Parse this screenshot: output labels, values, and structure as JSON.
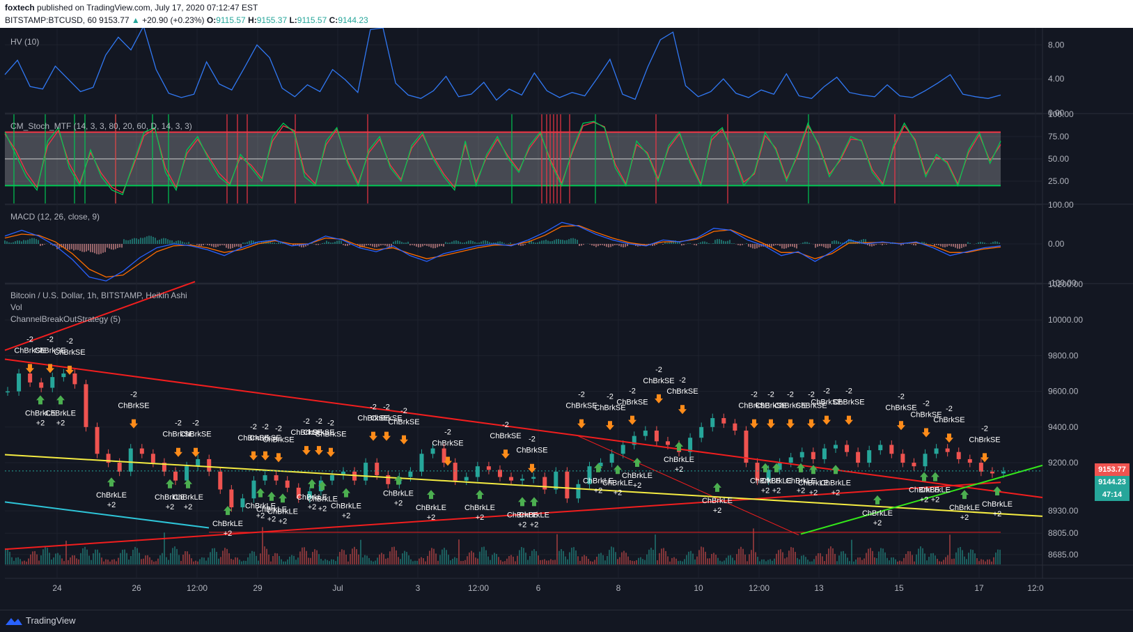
{
  "header": {
    "author": "foxtech",
    "published_text": "published on TradingView.com, July 17, 2020 07:12:47 EST",
    "symbol": "BITSTAMP:BTCUSD, 60",
    "last": "9153.77",
    "change": "+20.90 (+0.23%)",
    "change_arrow": "▲",
    "o_label": "O:",
    "o_value": "9115.57",
    "h_label": "H:",
    "h_value": "9155.37",
    "l_label": "L:",
    "l_value": "9115.57",
    "c_label": "C:",
    "c_value": "9144.23"
  },
  "panes": {
    "hv": {
      "title": "HV (10)",
      "ticks": [
        "8.00",
        "4.00",
        "0.00"
      ]
    },
    "stoch": {
      "title": "CM_Stoch_MTF (14, 3, 3, 80, 20, 60, D, 14, 3, 3)",
      "ticks": [
        "100.00",
        "75.00",
        "50.00",
        "25.00"
      ]
    },
    "macd": {
      "title": "MACD (12, 26, close, 9)",
      "ticks": [
        "100.00",
        "0.00",
        "-100.00"
      ]
    },
    "price": {
      "title": "Bitcoin / U.S. Dollar, 1h, BITSTAMP, Heikin Ashi",
      "vol_label": "Vol",
      "strategy_label": "ChannelBreakOutStrategy (5)",
      "ticks": [
        "10200.00",
        "10000.00",
        "9800.00",
        "9600.00",
        "9400.00",
        "9200.00",
        "8930.00",
        "8805.00",
        "8685.00"
      ]
    }
  },
  "price_tags": [
    {
      "value": "9153.77",
      "color": "#ef5350"
    },
    {
      "value": "9144.23",
      "color": "#26a69a"
    },
    {
      "value": "47:14",
      "color": "#26a69a"
    }
  ],
  "x_axis": [
    "24",
    "26",
    "12:00",
    "29",
    "Jul",
    "3",
    "12:00",
    "6",
    "8",
    "10",
    "12:00",
    "13",
    "15",
    "17",
    "12:0"
  ],
  "signals": {
    "short_label": "ChBrkSE",
    "short_qty": "-2",
    "long_label": "ChBrkLE",
    "long_qty": "+2"
  },
  "footer": {
    "logo_text": "TradingView"
  },
  "colors": {
    "background": "#131722",
    "grid": "#1e222d",
    "hv_line": "#3179f5",
    "stoch_k": "#00c853",
    "stoch_d": "#f23645",
    "macd_line": "#2962ff",
    "signal_line": "#ff6d00",
    "trend_red": "#f21e1e",
    "trend_yellow": "#f5ec42",
    "trend_cyan": "#2ec5d8",
    "trend_green": "#34e81a",
    "candle_up": "#26a69a",
    "candle_down": "#ef5350"
  },
  "chart_data": [
    {
      "type": "line",
      "pane": "HV (10)",
      "ylim": [
        0,
        10
      ],
      "series": [
        {
          "name": "HV (10)",
          "values": [
            4.5,
            6.2,
            3.1,
            2.8,
            5.5,
            4.0,
            2.5,
            3.0,
            6.8,
            8.9,
            7.4,
            10.2,
            5.1,
            2.3,
            1.8,
            2.2,
            6.0,
            3.4,
            2.7,
            5.3,
            8.0,
            6.5,
            2.9,
            1.9,
            3.3,
            2.5,
            5.1,
            3.9,
            2.4,
            9.8,
            10.0,
            3.5,
            2.1,
            1.7,
            2.6,
            4.3,
            1.9,
            2.2,
            3.6,
            1.5,
            2.8,
            2.1,
            4.7,
            2.6,
            1.8,
            2.4,
            2.0,
            4.1,
            6.3,
            2.2,
            1.6,
            5.4,
            8.6,
            9.5,
            3.2,
            1.9,
            2.5,
            4.0,
            2.3,
            1.8,
            2.7,
            2.2,
            4.6,
            2.0,
            1.7,
            3.1,
            4.2,
            2.4,
            2.1,
            1.9,
            3.3,
            2.0,
            1.8,
            2.6,
            3.5,
            4.5,
            2.2,
            1.9,
            1.7,
            2.1
          ]
        }
      ]
    },
    {
      "type": "line",
      "pane": "CM_Stoch_MTF (14, 3, 3, 80, 20, 60, D, 14, 3, 3)",
      "ylim": [
        0,
        100
      ],
      "series": [
        {
          "name": "K",
          "values": [
            80,
            55,
            30,
            15,
            70,
            85,
            40,
            20,
            60,
            30,
            15,
            10,
            45,
            80,
            85,
            35,
            15,
            60,
            75,
            50,
            30,
            20,
            55,
            40,
            25,
            75,
            90,
            80,
            30,
            20,
            70,
            85,
            45,
            20,
            60,
            75,
            40,
            25,
            65,
            80,
            50,
            30,
            15,
            70,
            20,
            55,
            75,
            50,
            35,
            65,
            80,
            45,
            20,
            60,
            90,
            92,
            85,
            40,
            20,
            70,
            55,
            25,
            65,
            80,
            45,
            20,
            75,
            85,
            55,
            20,
            35,
            80,
            60,
            25,
            55,
            90,
            65,
            30,
            50,
            75,
            70,
            35,
            20,
            65,
            90,
            70,
            30,
            55,
            45,
            20,
            60,
            80,
            45,
            70
          ]
        },
        {
          "name": "D",
          "values": [
            78,
            60,
            35,
            18,
            65,
            82,
            45,
            23,
            57,
            34,
            18,
            12,
            42,
            76,
            84,
            40,
            18,
            56,
            72,
            53,
            34,
            22,
            52,
            43,
            28,
            70,
            87,
            82,
            35,
            22,
            66,
            83,
            48,
            23,
            57,
            72,
            43,
            27,
            62,
            77,
            53,
            33,
            18,
            66,
            24,
            52,
            72,
            53,
            37,
            62,
            78,
            48,
            23,
            57,
            87,
            91,
            86,
            44,
            22,
            66,
            57,
            28,
            62,
            78,
            48,
            22,
            71,
            83,
            57,
            24,
            33,
            76,
            62,
            28,
            52,
            87,
            67,
            33,
            48,
            72,
            71,
            38,
            22,
            62,
            87,
            72,
            33,
            52,
            47,
            22,
            57,
            77,
            48,
            66
          ]
        }
      ]
    },
    {
      "type": "line",
      "pane": "MACD (12, 26, close, 9)",
      "ylim": [
        -100,
        100
      ],
      "series": [
        {
          "name": "MACD",
          "values": [
            20,
            35,
            20,
            -5,
            -40,
            -85,
            -95,
            -70,
            -35,
            -10,
            0,
            -5,
            -15,
            -30,
            -10,
            5,
            10,
            -5,
            0,
            20,
            10,
            -10,
            -20,
            -5,
            -30,
            -45,
            -25,
            -15,
            -5,
            0,
            -5,
            10,
            30,
            55,
            45,
            25,
            10,
            0,
            -5,
            10,
            5,
            15,
            40,
            35,
            10,
            -5,
            -30,
            -20,
            -45,
            -20,
            10,
            0,
            5,
            0,
            5,
            -10,
            -30,
            -20,
            -10,
            -5
          ]
        },
        {
          "name": "Signal",
          "values": [
            15,
            25,
            22,
            5,
            -25,
            -65,
            -85,
            -80,
            -50,
            -20,
            -5,
            -3,
            -10,
            -22,
            -15,
            0,
            8,
            0,
            0,
            15,
            12,
            -5,
            -15,
            -10,
            -25,
            -38,
            -30,
            -20,
            -10,
            -3,
            -3,
            5,
            22,
            45,
            47,
            30,
            15,
            3,
            -3,
            5,
            6,
            12,
            32,
            36,
            18,
            0,
            -22,
            -22,
            -38,
            -25,
            2,
            3,
            4,
            1,
            3,
            -5,
            -22,
            -22,
            -13,
            -8
          ]
        }
      ]
    },
    {
      "type": "line",
      "pane": "Bitcoin / U.S. Dollar, 1h, BITSTAMP, Heikin Ashi",
      "ylim": [
        8630,
        10200
      ],
      "series": [
        {
          "name": "Bitcoin / U.S. Dollar, 1h, BITSTAMP, Heikin Ashi",
          "values": [
            9600,
            9700,
            9650,
            9620,
            9680,
            9700,
            9640,
            9400,
            9250,
            9200,
            9150,
            9280,
            9250,
            9200,
            9150,
            9100,
            9180,
            9220,
            9150,
            9050,
            8950,
            9000,
            9100,
            9130,
            9100,
            9060,
            9000,
            9040,
            9100,
            9130,
            9150,
            9100,
            9200,
            9130,
            9080,
            9120,
            9150,
            9250,
            9280,
            9200,
            9100,
            9120,
            9180,
            9160,
            9120,
            9100,
            9110,
            9120,
            9050,
            9150,
            9000,
            9080,
            9180,
            9200,
            9250,
            9300,
            9350,
            9380,
            9320,
            9300,
            9260,
            9340,
            9400,
            9450,
            9420,
            9380,
            9200,
            9100,
            9160,
            9200,
            9230,
            9260,
            9220,
            9280,
            9300,
            9260,
            9200,
            9270,
            9300,
            9250,
            9200,
            9180,
            9250,
            9280,
            9260,
            9220,
            9200,
            9150,
            9140,
            9150
          ]
        }
      ]
    }
  ]
}
